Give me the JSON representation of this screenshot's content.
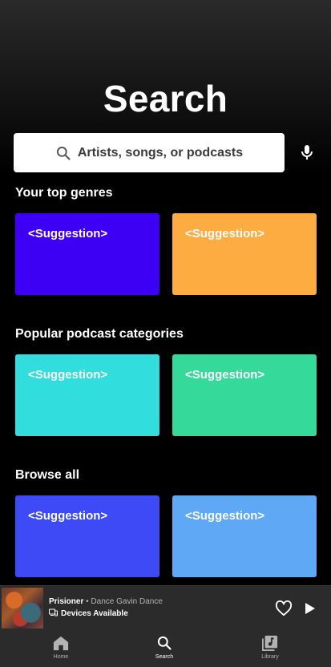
{
  "header": {
    "title": "Search"
  },
  "search": {
    "placeholder": "Artists, songs, or podcasts"
  },
  "sections": [
    {
      "title": "Your top genres",
      "cards": [
        {
          "label": "<Suggestion>",
          "color": "#3d00f5"
        },
        {
          "label": "<Suggestion>",
          "color": "#fdac42"
        }
      ]
    },
    {
      "title": "Popular podcast categories",
      "cards": [
        {
          "label": "<Suggestion>",
          "color": "#32dddd"
        },
        {
          "label": "<Suggestion>",
          "color": "#35d99a"
        }
      ]
    },
    {
      "title": "Browse all",
      "cards": [
        {
          "label": "<Suggestion>",
          "color": "#3d4af5"
        },
        {
          "label": "<Suggestion>",
          "color": "#5fa8f6"
        }
      ]
    }
  ],
  "player": {
    "song": "Prisioner",
    "separator": " • ",
    "artist": "Dance Gavin Dance",
    "devices": "Devices Available",
    "icons": [
      "heart-icon",
      "play-icon",
      "devices-icon"
    ]
  },
  "tabs": [
    {
      "label": "Home",
      "icon": "home-icon",
      "active": false
    },
    {
      "label": "Search",
      "icon": "search-icon",
      "active": true
    },
    {
      "label": "Library",
      "icon": "library-icon",
      "active": false
    }
  ],
  "colors": {
    "background": "#000000",
    "bar": "#2b2b2b",
    "text": "#ffffff",
    "muted": "#b3b3b3"
  }
}
